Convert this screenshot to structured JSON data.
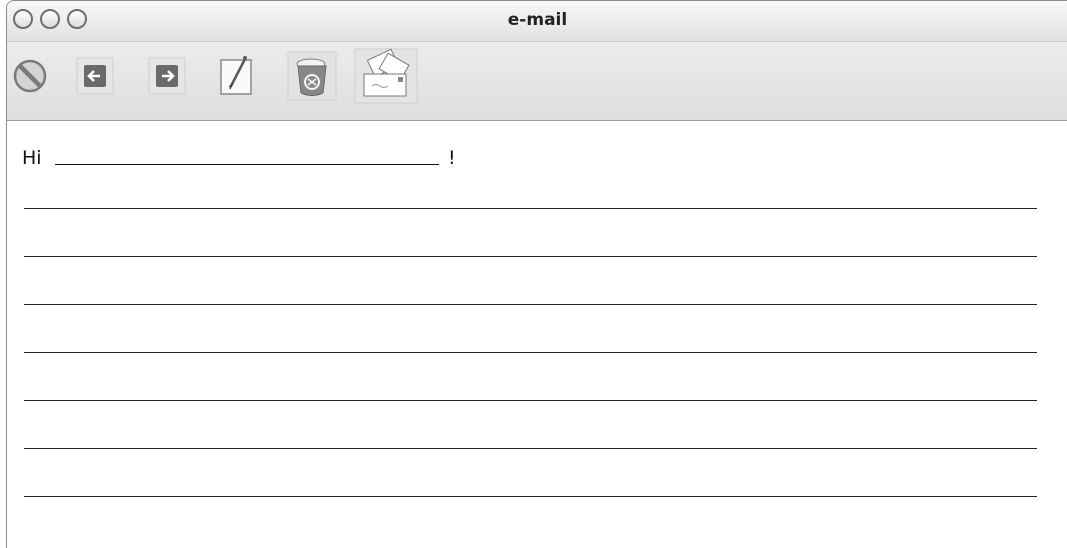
{
  "window": {
    "title": "e-mail"
  },
  "toolbar": {
    "buttons": [
      {
        "name": "stop-button",
        "icon": "stop-icon"
      },
      {
        "name": "back-button",
        "icon": "arrow-left-icon"
      },
      {
        "name": "forward-button",
        "icon": "arrow-right-icon"
      },
      {
        "name": "compose-button",
        "icon": "pencil-icon"
      },
      {
        "name": "recycle-button",
        "icon": "recycle-bin-icon"
      },
      {
        "name": "mail-button",
        "icon": "envelopes-icon"
      }
    ]
  },
  "letter": {
    "greeting": "Hi",
    "punctuation": "!",
    "blank_lines": 7
  }
}
